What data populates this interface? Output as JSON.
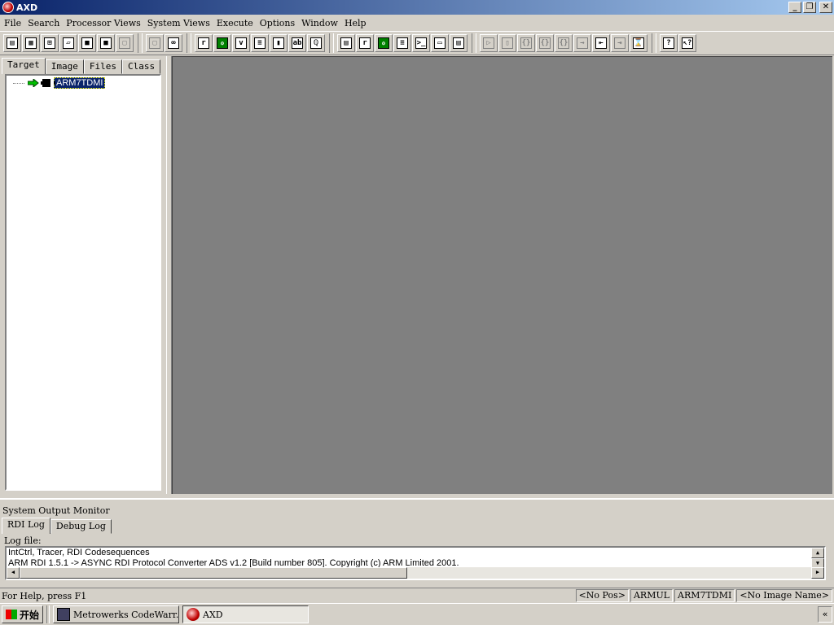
{
  "window": {
    "title": "AXD",
    "buttons": {
      "minimize": "_",
      "restore": "❐",
      "close": "✕"
    }
  },
  "menubar": [
    {
      "label": "File",
      "mnemonic_index": 0
    },
    {
      "label": "Search"
    },
    {
      "label": "Processor Views"
    },
    {
      "label": "System Views"
    },
    {
      "label": "Execute"
    },
    {
      "label": "Options"
    },
    {
      "label": "Window"
    },
    {
      "label": "Help"
    }
  ],
  "toolbar": {
    "groups": [
      [
        {
          "icon": "load-image-icon",
          "glyph": "▤"
        },
        {
          "icon": "reload-image-icon",
          "glyph": "▦"
        },
        {
          "icon": "configure-target-icon",
          "glyph": "⊞"
        },
        {
          "icon": "open-file-icon",
          "glyph": "▱"
        },
        {
          "icon": "chip-save-icon",
          "glyph": "■"
        },
        {
          "icon": "chip-load-icon",
          "glyph": "■"
        },
        {
          "icon": "copy-disabled-icon",
          "glyph": "▢",
          "disabled": true
        }
      ],
      [
        {
          "icon": "find-disabled-icon",
          "glyph": "▢",
          "disabled": true
        },
        {
          "icon": "binoculars-icon",
          "glyph": "∞"
        }
      ],
      [
        {
          "icon": "registers-icon",
          "glyph": "r"
        },
        {
          "icon": "watch-icon",
          "glyph": "ℴ",
          "green": true
        },
        {
          "icon": "variables-icon",
          "glyph": "v"
        },
        {
          "icon": "backtrace-icon",
          "glyph": "≡"
        },
        {
          "icon": "memory-icon",
          "glyph": "▮"
        },
        {
          "icon": "low-level-symbols-icon",
          "glyph": "ab"
        },
        {
          "icon": "disassembly-icon",
          "glyph": "ℚ"
        }
      ],
      [
        {
          "icon": "system-registers-icon",
          "glyph": "▤"
        },
        {
          "icon": "system-r-icon",
          "glyph": "r"
        },
        {
          "icon": "system-watch-icon",
          "glyph": "ℴ",
          "green": true
        },
        {
          "icon": "system-list-icon",
          "glyph": "≡"
        },
        {
          "icon": "command-line-icon",
          "glyph": ">_"
        },
        {
          "icon": "output-icon",
          "glyph": "▭"
        },
        {
          "icon": "source-files-icon",
          "glyph": "▤"
        }
      ],
      [
        {
          "icon": "go-disabled-icon",
          "glyph": "▷",
          "disabled": true
        },
        {
          "icon": "stop-disabled-icon",
          "glyph": "▯",
          "disabled": true
        },
        {
          "icon": "step-in-disabled-icon",
          "glyph": "{}",
          "disabled": true
        },
        {
          "icon": "step-disabled-icon",
          "glyph": "{}",
          "disabled": true
        },
        {
          "icon": "step-out-disabled-icon",
          "glyph": "{}",
          "disabled": true
        },
        {
          "icon": "run-to-cursor-disabled-icon",
          "glyph": "→",
          "disabled": true
        },
        {
          "icon": "toggle-breakpoint-icon",
          "glyph": "⇤"
        },
        {
          "icon": "watchpoint-disabled-icon",
          "glyph": "⇥",
          "disabled": true
        },
        {
          "icon": "hourglass-icon",
          "glyph": "⌛"
        }
      ],
      [
        {
          "icon": "help-icon",
          "glyph": "?"
        },
        {
          "icon": "context-help-icon",
          "glyph": "↖?"
        }
      ]
    ]
  },
  "left_panel": {
    "tabs": [
      "Target",
      "Image",
      "Files",
      "Class"
    ],
    "active_tab": 0,
    "tree": [
      {
        "label": "ARM7TDMI",
        "selected": true
      }
    ]
  },
  "output_monitor": {
    "title": "System Output Monitor",
    "tabs": [
      "RDI Log",
      "Debug Log"
    ],
    "active_tab": 0,
    "log_file_label": "Log file:",
    "log_lines": [
      "IntCtrl, Tracer, RDI Codesequences",
      "ARM RDI 1.5.1 -> ASYNC RDI Protocol Converter ADS v1.2 [Build number 805]. Copyright (c) ARM Limited 2001."
    ]
  },
  "statusbar": {
    "help": "For Help, press F1",
    "panes": [
      "<No Pos>",
      "ARMUL",
      "ARM7TDMI",
      "<No Image Name>"
    ]
  },
  "taskbar": {
    "start_label": "开始",
    "tasks": [
      {
        "label": "Metrowerks CodeWarr...",
        "icon": "codewarrior-icon",
        "active": false
      },
      {
        "label": "AXD",
        "icon": "axd-icon",
        "active": true
      }
    ],
    "tray_label": "«"
  },
  "colors": {
    "titlebar_start": "#0a246a",
    "titlebar_end": "#a6caf0",
    "face": "#d4d0c8",
    "mdi_background": "#808080",
    "selection": "#0a246a"
  }
}
